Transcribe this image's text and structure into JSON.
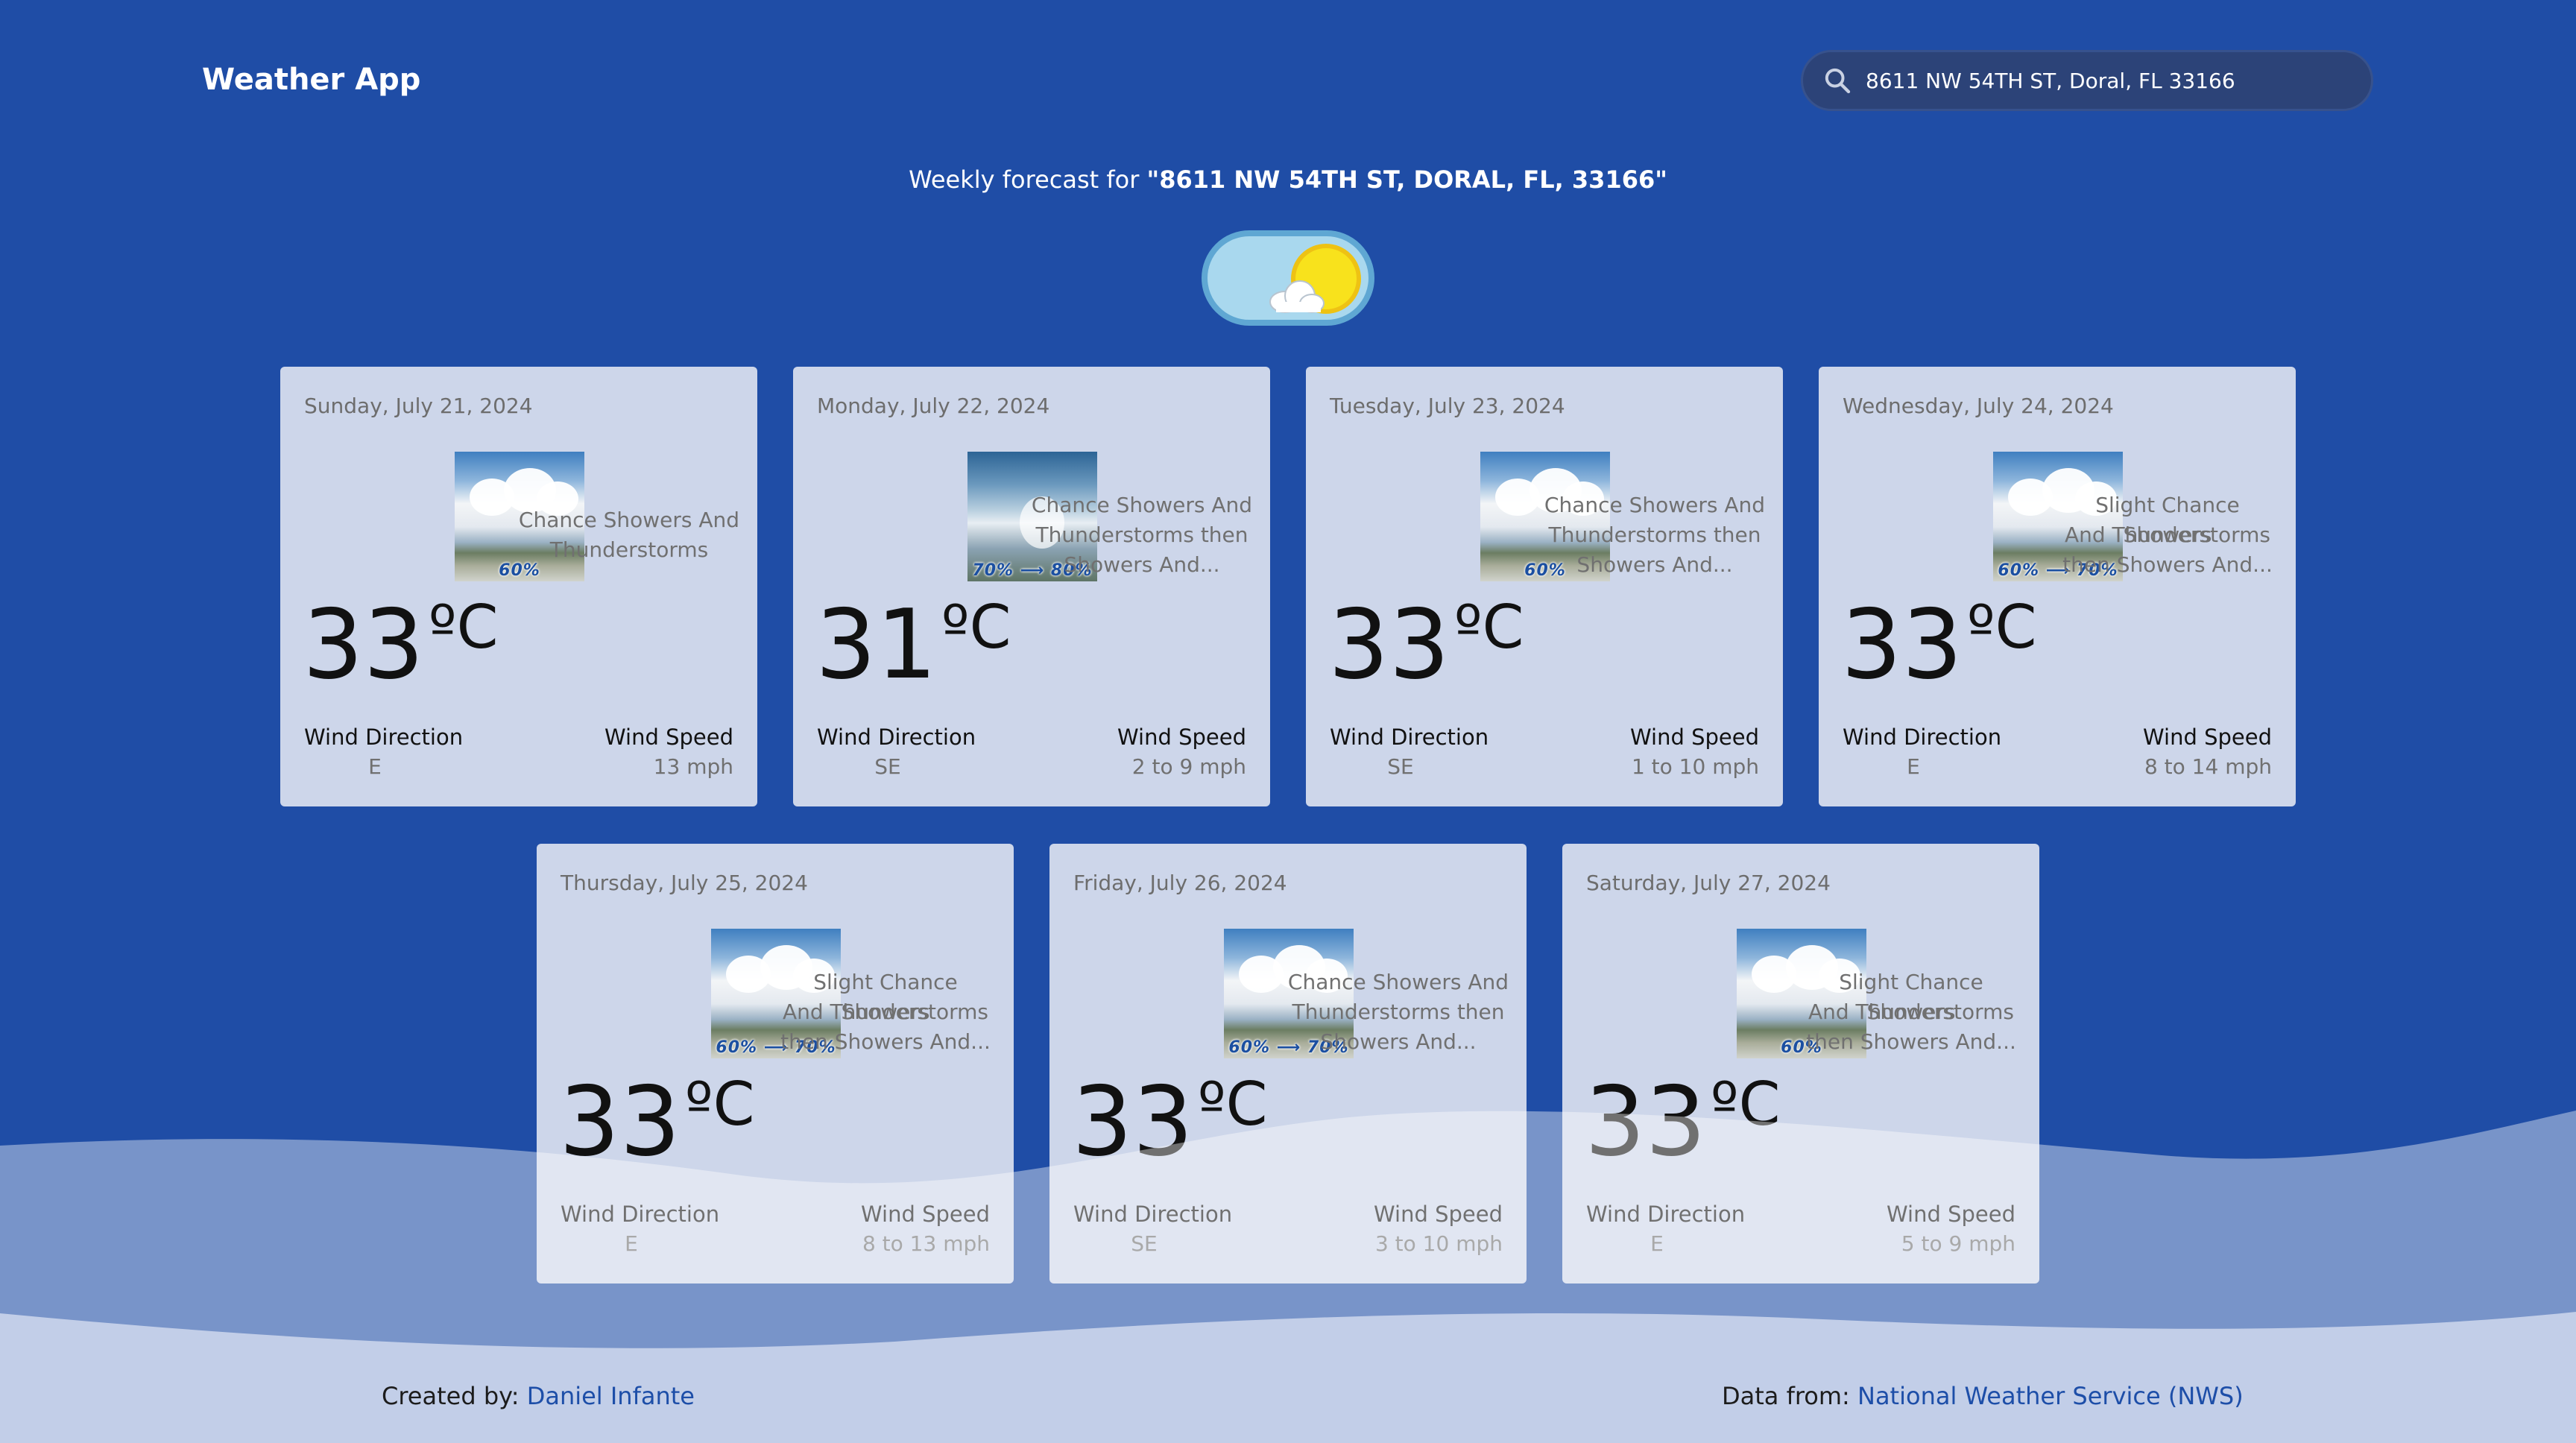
{
  "app": {
    "title": "Weather App"
  },
  "search": {
    "value": "8611 NW 54TH ST, Doral, FL 33166"
  },
  "heading": {
    "prefix": "Weekly forecast for",
    "address": "\"8611 NW 54TH ST, DORAL, FL, 33166\""
  },
  "theme_toggle": {
    "icon": "sun-cloud-icon"
  },
  "labels": {
    "wind_direction": "Wind Direction",
    "wind_speed": "Wind Speed",
    "unit": "ºC"
  },
  "days": [
    {
      "date": "Sunday, July 21, 2024",
      "image_label": "60%",
      "temp": "33",
      "desc": [
        "Chance Showers And",
        "Thunderstorms"
      ],
      "wind_dir": "E",
      "wind_speed": "13 mph"
    },
    {
      "date": "Monday, July 22, 2024",
      "image_label": "70% ⟶ 80%",
      "temp": "31",
      "desc": [
        "Chance Showers And",
        "Thunderstorms then",
        "Showers And..."
      ],
      "wind_dir": "SE",
      "wind_speed": "2 to 9 mph"
    },
    {
      "date": "Tuesday, July 23, 2024",
      "image_label": "60%",
      "temp": "33",
      "desc": [
        "Chance Showers And",
        "Thunderstorms then",
        "Showers And..."
      ],
      "wind_dir": "SE",
      "wind_speed": "1 to 10 mph"
    },
    {
      "date": "Wednesday, July 24, 2024",
      "image_label": "60% ⟶ 70%",
      "temp": "33",
      "desc": [
        "Slight Chance Showers",
        "And Thunderstorms",
        "then Showers And..."
      ],
      "wind_dir": "E",
      "wind_speed": "8 to 14 mph"
    },
    {
      "date": "Thursday, July 25, 2024",
      "image_label": "60% ⟶ 70%",
      "temp": "33",
      "desc": [
        "Slight Chance Showers",
        "And Thunderstorms",
        "then Showers And..."
      ],
      "wind_dir": "E",
      "wind_speed": "8 to 13 mph"
    },
    {
      "date": "Friday, July 26, 2024",
      "image_label": "60% ⟶ 70%",
      "temp": "33",
      "desc": [
        "Chance Showers And",
        "Thunderstorms then",
        "Showers And..."
      ],
      "wind_dir": "SE",
      "wind_speed": "3 to 10 mph"
    },
    {
      "date": "Saturday, July 27, 2024",
      "image_label": "60%",
      "temp": "33",
      "desc": [
        "Slight Chance Showers",
        "And Thunderstorms",
        "then Showers And..."
      ],
      "wind_dir": "E",
      "wind_speed": "5 to 9 mph"
    }
  ],
  "footer": {
    "created_prefix": "Created by:",
    "created_name": "Daniel Infante",
    "data_prefix": "Data from:",
    "data_source": "National Weather Service (NWS)"
  },
  "colors": {
    "background": "#1f4da6",
    "card": "#cdd6ea",
    "link": "#1d4ea8",
    "search_bg": "#2c4378"
  }
}
